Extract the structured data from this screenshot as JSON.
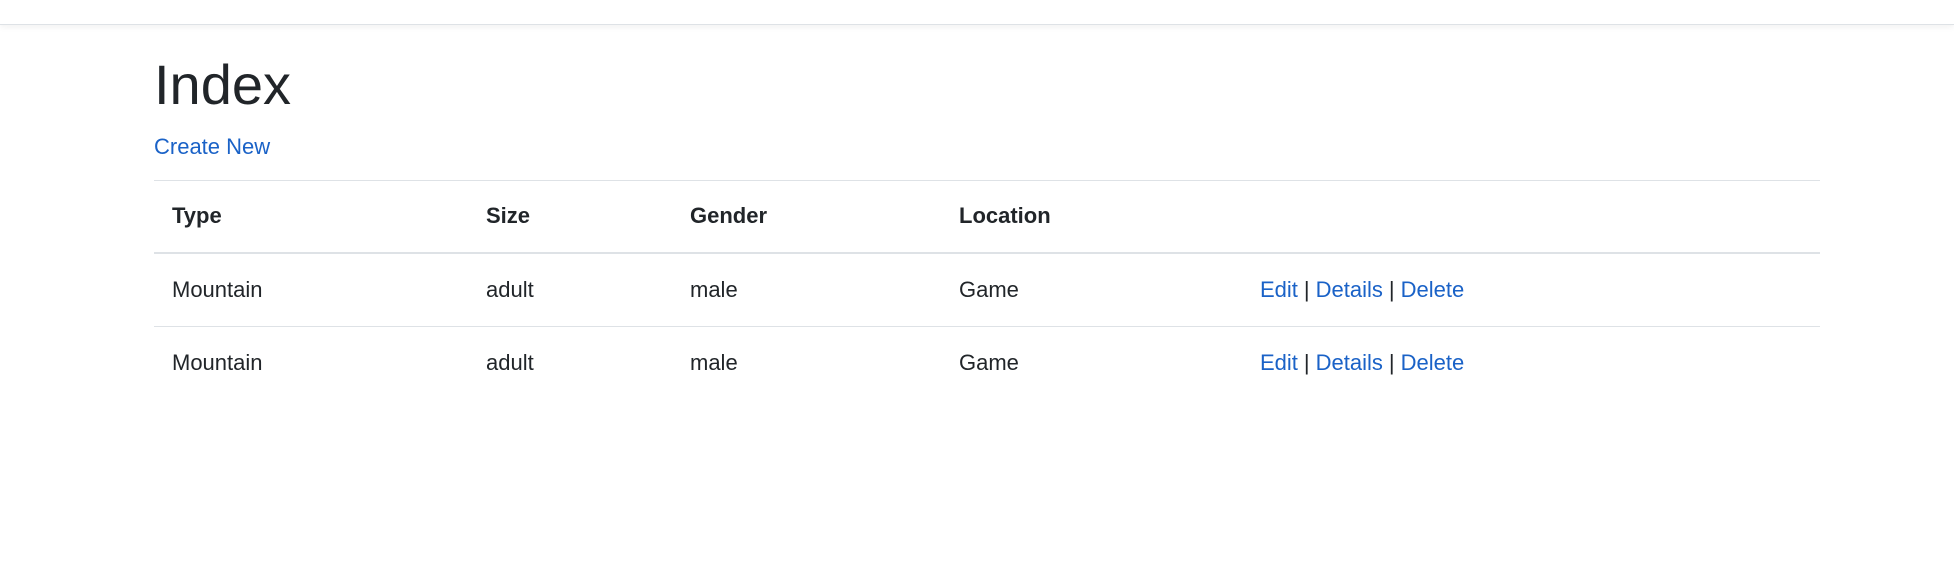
{
  "page": {
    "title": "Index",
    "create_link": "Create New"
  },
  "table": {
    "headers": [
      "Type",
      "Size",
      "Gender",
      "Location",
      ""
    ],
    "rows": [
      {
        "type": "Mountain",
        "size": "adult",
        "gender": "male",
        "location": "Game",
        "actions": {
          "edit": "Edit",
          "details": "Details",
          "delete": "Delete",
          "separator": "|"
        }
      },
      {
        "type": "Mountain",
        "size": "adult",
        "gender": "male",
        "location": "Game",
        "actions": {
          "edit": "Edit",
          "details": "Details",
          "delete": "Delete",
          "separator": "|"
        }
      }
    ]
  },
  "colors": {
    "link": "#1a62c7",
    "text": "#212529",
    "border": "#dee2e6"
  }
}
